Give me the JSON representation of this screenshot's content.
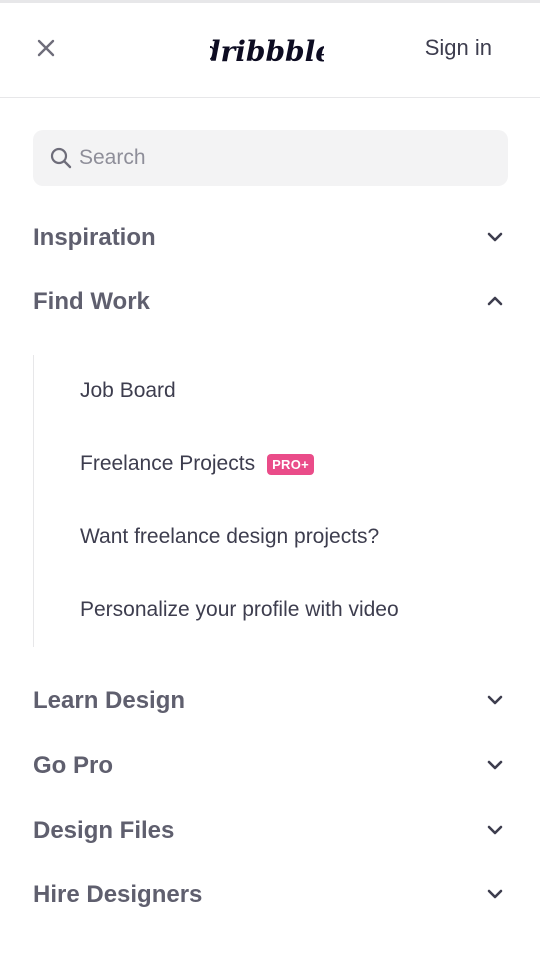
{
  "header": {
    "logo_text": "dribbble",
    "signin_label": "Sign in",
    "close_icon": "close-icon"
  },
  "search": {
    "placeholder": "Search",
    "value": ""
  },
  "nav": {
    "items": [
      {
        "label": "Inspiration",
        "expanded": false
      },
      {
        "label": "Find Work",
        "expanded": true
      },
      {
        "label": "Learn Design",
        "expanded": false
      },
      {
        "label": "Go Pro",
        "expanded": false
      },
      {
        "label": "Design Files",
        "expanded": false
      },
      {
        "label": "Hire Designers",
        "expanded": false
      }
    ],
    "find_work_sub": [
      {
        "label": "Job Board"
      },
      {
        "label": "Freelance Projects",
        "badge": "PRO+"
      },
      {
        "label": "Want freelance design projects?"
      },
      {
        "label": "Personalize your profile with video"
      }
    ]
  },
  "colors": {
    "text": "#3d3d4e",
    "nav_text": "#5f5f6e",
    "badge": "#ea4c89",
    "search_bg": "#f3f3f4"
  }
}
